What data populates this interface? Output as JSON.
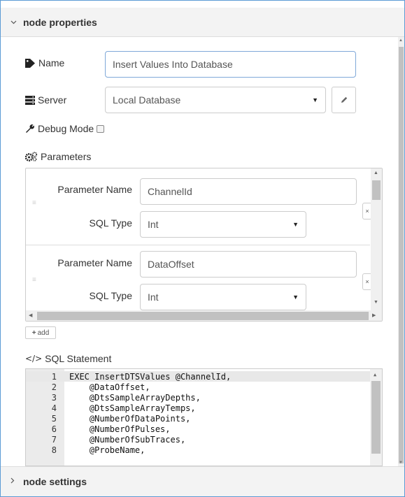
{
  "sections": {
    "properties_title": "node properties",
    "settings_title": "node settings"
  },
  "fields": {
    "name_label": "Name",
    "name_value": "Insert Values Into Database",
    "server_label": "Server",
    "server_value": "Local Database",
    "debug_label": "Debug Mode",
    "debug_checked": false,
    "parameters_label": "Parameters"
  },
  "parameters": [
    {
      "name_label": "Parameter Name",
      "name_value": "ChannelId",
      "type_label": "SQL Type",
      "type_value": "Int"
    },
    {
      "name_label": "Parameter Name",
      "name_value": "DataOffset",
      "type_label": "SQL Type",
      "type_value": "Int"
    }
  ],
  "add_button": "add",
  "sql": {
    "label": "SQL Statement",
    "lines": [
      {
        "n": "1",
        "text": "EXEC InsertDTSValues @ChannelId,"
      },
      {
        "n": "2",
        "text": "    @DataOffset,"
      },
      {
        "n": "3",
        "text": "    @DtsSampleArrayDepths,"
      },
      {
        "n": "4",
        "text": "    @DtsSampleArrayTemps,"
      },
      {
        "n": "5",
        "text": "    @NumberOfDataPoints,"
      },
      {
        "n": "6",
        "text": "    @NumberOfPulses,"
      },
      {
        "n": "7",
        "text": "    @NumberOfSubTraces,"
      },
      {
        "n": "8",
        "text": "    @ProbeName,"
      }
    ]
  },
  "icons": {
    "name": "tag-icon",
    "server": "server-icon",
    "debug": "wrench-icon",
    "parameters": "gears-icon",
    "edit": "pencil-icon",
    "sql": "code-icon",
    "collapse": "chevron-down-icon",
    "expand": "chevron-right-icon"
  }
}
